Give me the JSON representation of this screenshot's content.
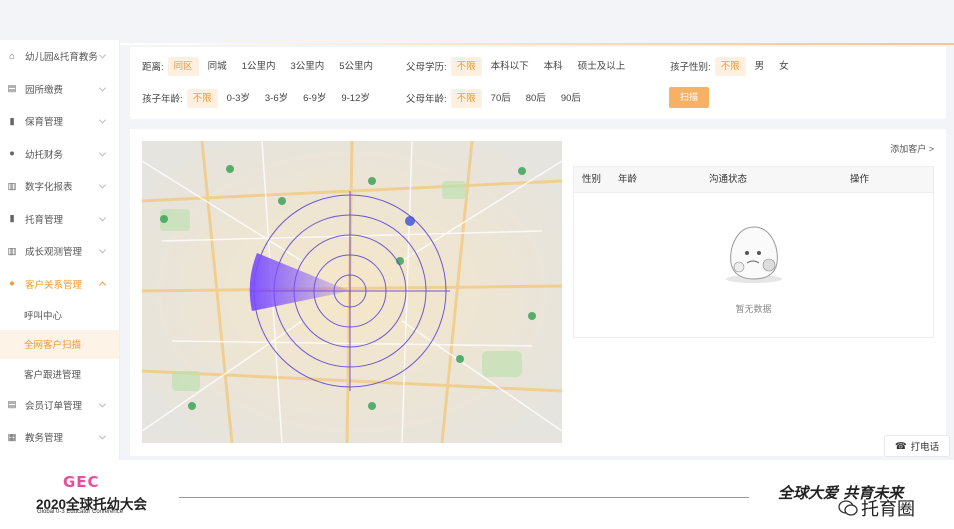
{
  "sidebar": {
    "items": [
      {
        "label": "幼儿园&托育教务",
        "icon": "home-icon"
      },
      {
        "label": "园所缴费",
        "icon": "card-icon"
      },
      {
        "label": "保育管理",
        "icon": "clipboard-icon"
      },
      {
        "label": "幼托财务",
        "icon": "coin-icon"
      },
      {
        "label": "数字化报表",
        "icon": "bar-chart-icon"
      },
      {
        "label": "托育管理",
        "icon": "clipboard-icon"
      },
      {
        "label": "成长观测管理",
        "icon": "bar-chart-icon"
      },
      {
        "label": "客户关系管理",
        "icon": "user-icon"
      }
    ],
    "sub_items": [
      "呼叫中心",
      "全网客户扫描",
      "客户跟进管理"
    ],
    "after_items": [
      {
        "label": "会员订单管理",
        "icon": "card-icon"
      },
      {
        "label": "教务管理",
        "icon": "grid-icon"
      }
    ]
  },
  "filters": {
    "distance": {
      "label": "距离:",
      "options": [
        "同区",
        "同城",
        "1公里内",
        "3公里内",
        "5公里内"
      ]
    },
    "parent_edu": {
      "label": "父母学历:",
      "options": [
        "不限",
        "本科以下",
        "本科",
        "硕士及以上"
      ]
    },
    "child_gender": {
      "label": "孩子性别:",
      "options": [
        "不限",
        "男",
        "女"
      ]
    },
    "child_age": {
      "label": "孩子年龄:",
      "options": [
        "不限",
        "0-3岁",
        "3-6岁",
        "6-9岁",
        "9-12岁"
      ]
    },
    "parent_age": {
      "label": "父母年龄:",
      "options": [
        "不限",
        "70后",
        "80后",
        "90后"
      ]
    },
    "scan_label": "扫描"
  },
  "results": {
    "add_customer": "添加客户 >",
    "columns": [
      "性别",
      "年龄",
      "沟通状态",
      "操作"
    ],
    "empty_text": "暂无数据"
  },
  "call_button": "打电话",
  "footer": {
    "gec": "GEC",
    "title": "2020全球托幼大会",
    "subtitle": "Global 0-3 Educator Conference",
    "slogan": "全球大爱 共育未来",
    "watermark": "托育圈"
  },
  "colors": {
    "accent": "#f39a33",
    "radar": "#5a3fd1"
  }
}
